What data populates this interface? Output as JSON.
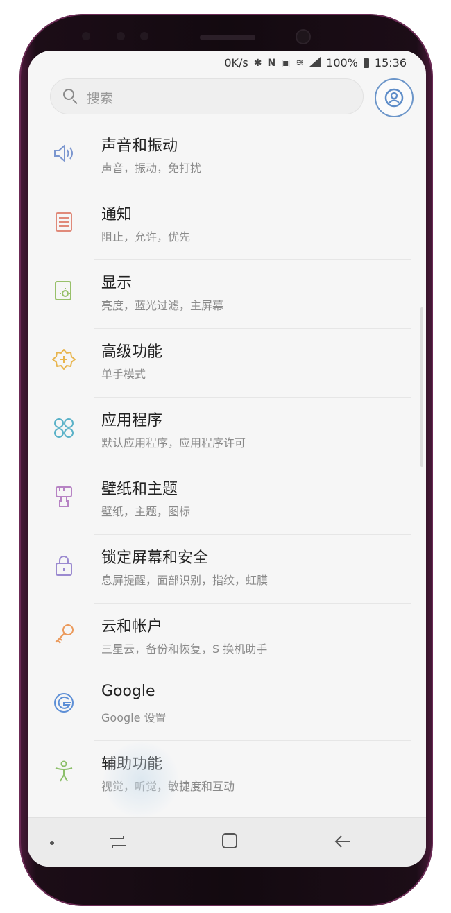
{
  "status": {
    "speed": "0K/s",
    "battery": "100%",
    "time": "15:36",
    "icons": [
      "bluetooth-icon",
      "nfc-icon",
      "sim-icon",
      "wifi-icon",
      "signal-icon",
      "battery-icon"
    ]
  },
  "search": {
    "placeholder": "搜索"
  },
  "settings": [
    {
      "title": "声音和振动",
      "subtitle": "声音，振动，免打扰",
      "icon": "volume-icon",
      "color": "#7b96cf"
    },
    {
      "title": "通知",
      "subtitle": "阻止，允许，优先",
      "icon": "notification-icon",
      "color": "#e08a7a"
    },
    {
      "title": "显示",
      "subtitle": "亮度，蓝光过滤，主屏幕",
      "icon": "display-icon",
      "color": "#98c06a"
    },
    {
      "title": "高级功能",
      "subtitle": "单手模式",
      "icon": "advanced-features-icon",
      "color": "#e8b54e"
    },
    {
      "title": "应用程序",
      "subtitle": "默认应用程序，应用程序许可",
      "icon": "apps-icon",
      "color": "#5bb2c8"
    },
    {
      "title": "壁纸和主题",
      "subtitle": "壁纸，主题，图标",
      "icon": "wallpaper-brush-icon",
      "color": "#b783c4"
    },
    {
      "title": "锁定屏幕和安全",
      "subtitle": "息屏提醒，面部识别，指纹，虹膜",
      "icon": "lock-icon",
      "color": "#9b8ad0"
    },
    {
      "title": "云和帐户",
      "subtitle": "三星云，备份和恢复，S 换机助手",
      "icon": "key-icon",
      "color": "#eb9a5c"
    },
    {
      "title": "Google",
      "subtitle": "Google 设置",
      "icon": "google-icon",
      "color": "#5d8fd6"
    },
    {
      "title": "辅助功能",
      "subtitle": "视觉，听觉，敏捷度和互动",
      "icon": "accessibility-icon",
      "color": "#8cbf6a"
    }
  ],
  "navbar": {
    "buttons": [
      "recent-apps",
      "home",
      "back"
    ]
  }
}
